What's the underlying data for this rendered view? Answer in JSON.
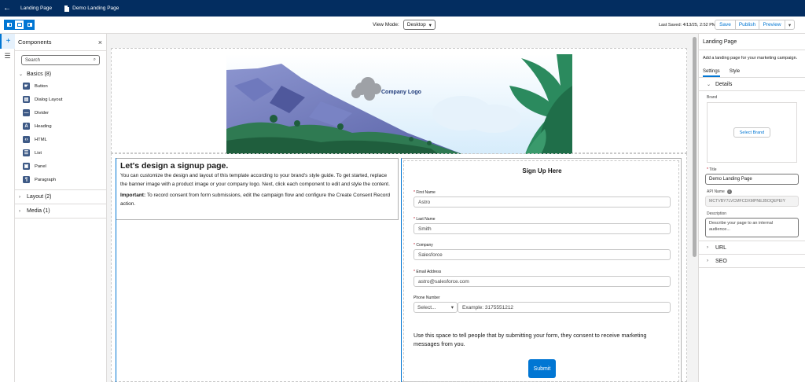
{
  "topbar": {
    "back_icon": "arrow-left-icon",
    "tab_landing": "Landing Page",
    "tab_demo": "Demo Landing Page"
  },
  "toolbar": {
    "view_mode_label": "View Mode:",
    "view_mode_value": "Desktop",
    "last_saved": "Last Saved: 4/13/25, 2:52 PM",
    "save": "Save",
    "publish": "Publish",
    "preview": "Preview"
  },
  "components": {
    "title": "Components",
    "search_placeholder": "Search",
    "basics": "Basics (8)",
    "items": [
      {
        "label": "Button",
        "icon": "button-icon",
        "glyph": "☛"
      },
      {
        "label": "Dialog Layout",
        "icon": "dialog-layout-icon",
        "glyph": "▤"
      },
      {
        "label": "Divider",
        "icon": "divider-icon",
        "glyph": "—"
      },
      {
        "label": "Heading",
        "icon": "heading-icon",
        "glyph": "A"
      },
      {
        "label": "HTML",
        "icon": "html-icon",
        "glyph": "‹›"
      },
      {
        "label": "List",
        "icon": "list-icon",
        "glyph": "☰"
      },
      {
        "label": "Panel",
        "icon": "panel-icon",
        "glyph": "▣"
      },
      {
        "label": "Paragraph",
        "icon": "paragraph-icon",
        "glyph": "¶"
      }
    ],
    "layout": "Layout (2)",
    "media": "Media (1)"
  },
  "banner": {
    "logo_text": "Company Logo"
  },
  "content": {
    "heading": "Let's design a signup page.",
    "paragraph": "You can customize the design and layout of this template according to your brand's style guide. To get started, replace the banner image with a product image or your company logo. Next, click each component to edit and style the content.",
    "important_label": "Important:",
    "important_text": " To record consent from form submissions, edit the campaign flow and configure the Create Consent Record action."
  },
  "form": {
    "title": "Sign Up Here",
    "first_name_label": "First Name",
    "first_name_value": "Astro",
    "last_name_label": "Last Name",
    "last_name_value": "Smith",
    "company_label": "Company",
    "company_value": "Salesforce",
    "email_label": "Email Address",
    "email_value": "astro@salesforce.com",
    "phone_label": "Phone Number",
    "phone_select": "Select...",
    "phone_placeholder": "Example: 3175551212",
    "consent_text": "Use this space to tell people that by submitting your form, they consent to receive marketing messages from you.",
    "submit": "Submit"
  },
  "right_panel": {
    "title": "Landing Page",
    "description": "Add a landing page for your marketing campaign.",
    "tab_settings": "Settings",
    "tab_style": "Style",
    "details": "Details",
    "brand_label": "Brand",
    "select_brand": "Select Brand",
    "title_label": "Title",
    "title_value": "Demo Landing Page",
    "api_name_label": "API Name",
    "api_name_value": "MCTVBY7LVCMFCDXMPNEJBOQEPEIY",
    "description_label": "Description",
    "description_placeholder": "Describe your page to an internal audience...",
    "url": "URL",
    "seo": "SEO"
  },
  "colors": {
    "brand_blue": "#0176d3",
    "nav_navy": "#032d60"
  }
}
